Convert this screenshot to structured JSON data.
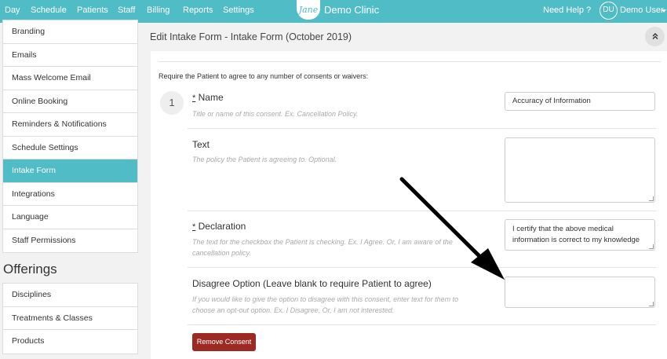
{
  "topnav": {
    "items": [
      "Day",
      "Schedule",
      "Patients",
      "Staff",
      "Billing",
      "Reports",
      "Settings"
    ],
    "logo_text": "Jane",
    "clinic_name": "Demo Clinic",
    "help_label": "Need Help ?",
    "avatar_initials": "DU",
    "user_name": "Demo User"
  },
  "sidebar": {
    "settings_items": [
      {
        "label": "Branding"
      },
      {
        "label": "Emails"
      },
      {
        "label": "Mass Welcome Email"
      },
      {
        "label": "Online Booking"
      },
      {
        "label": "Reminders & Notifications"
      },
      {
        "label": "Schedule Settings"
      },
      {
        "label": "Intake Form",
        "active": true
      },
      {
        "label": "Integrations"
      },
      {
        "label": "Language"
      },
      {
        "label": "Staff Permissions"
      }
    ],
    "offerings_title": "Offerings",
    "offerings_items": [
      {
        "label": "Disciplines"
      },
      {
        "label": "Treatments & Classes"
      },
      {
        "label": "Products"
      }
    ]
  },
  "main": {
    "title": "Edit Intake Form - Intake Form (October 2019)",
    "collapse_icon": "double-chevron-up-icon",
    "intro": "Require the Patient to agree to any number of consents or waivers:",
    "consent_number": "1",
    "name_field": {
      "required_mark": "*",
      "label": "Name",
      "help": "Title or name of this consent. Ex. Cancellation Policy.",
      "value": "Accuracy of Information"
    },
    "text_field": {
      "label": "Text",
      "help": "The policy the Patient is agreeing to. Optional.",
      "value": ""
    },
    "declaration_field": {
      "required_mark": "*",
      "label": "Declaration",
      "help": "The text for the checkbox the Patient is checking. Ex. I Agree. Or, I am aware of the cancellation policy.",
      "value": "I certify that the above medical information is correct to my knowledge"
    },
    "disagree_field": {
      "label": "Disagree Option (Leave blank to require Patient to agree)",
      "help": "If you would like to give the option to disagree with this consent, enter text for them to choose an opt-out option. Ex. I Disagree. Or, I am not interested.",
      "value": ""
    },
    "remove_label": "Remove Consent"
  },
  "colors": {
    "brand": "#4fbcc6",
    "danger": "#9c2a22"
  }
}
